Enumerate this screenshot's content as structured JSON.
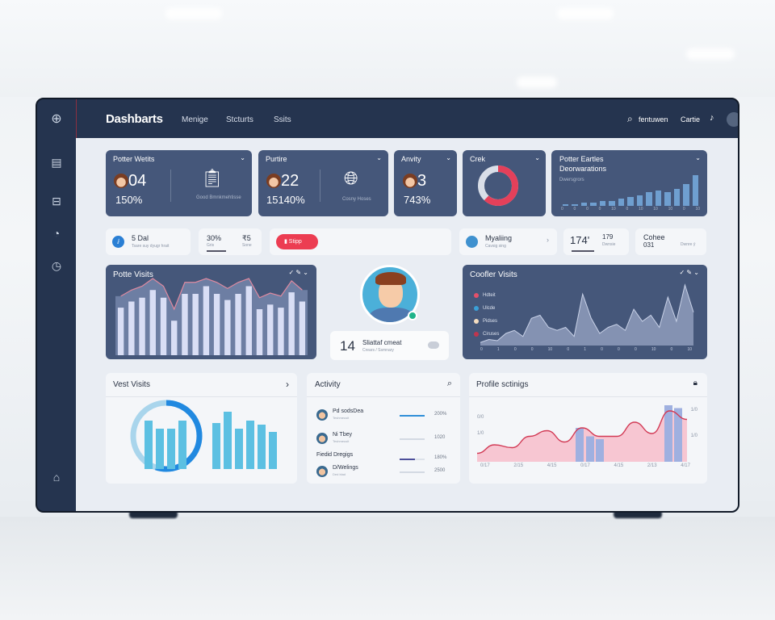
{
  "header": {
    "title": "Dashbarts",
    "nav": [
      "Menige",
      "Stcturts",
      "Ssits"
    ],
    "search_label": "fentuwen",
    "link": "Cartie"
  },
  "cards": [
    {
      "title": "Potter Wetits",
      "value": "04",
      "pct": "150%",
      "sub": "Good Bmnkmehtisse"
    },
    {
      "title": "Purtire",
      "value": "22",
      "pct": "15140%",
      "sub": "Cosny Hoses"
    },
    {
      "title": "Anvity",
      "value": "3",
      "pct": "743%"
    },
    {
      "title": "Crek",
      "donut_fraction": 0.62
    },
    {
      "title": "Potter Eartles",
      "subtitle": "Deorwarations",
      "legend": "Dwersgrors",
      "values": [
        1,
        1,
        2,
        2,
        3,
        3,
        5,
        6,
        7,
        9,
        10,
        9,
        11,
        14,
        20
      ],
      "ticks": [
        "0",
        "0",
        "0",
        "0",
        "10",
        "0",
        "10",
        "10",
        "10",
        "0",
        "10"
      ]
    }
  ],
  "pills": [
    {
      "title": "5 Dal",
      "sub": "Tsare suy dyugr hrait"
    },
    {
      "value1": "30%",
      "sub1": "Gris",
      "value2": "₹5",
      "sub2": "Sone"
    },
    {
      "button": "Stipp"
    },
    {
      "title": "Myaliing",
      "sub": "Cavsig sing"
    },
    {
      "value": "174'",
      "value2": "179",
      "sub": "Dwnsie"
    },
    {
      "title": "Cohee",
      "value": "031",
      "sub": "Dwnre ý"
    }
  ],
  "profile_visits": {
    "title": "Potte Visits",
    "values": [
      0.62,
      0.7,
      0.75,
      0.85,
      0.75,
      0.45,
      0.8,
      0.8,
      0.9,
      0.8,
      0.72,
      0.8,
      0.9,
      0.6,
      0.66,
      0.62,
      0.82,
      0.7
    ]
  },
  "profile": {
    "stat_value": "14",
    "stat_label": "Sliattaf cmeat",
    "stat_sub": "Crears / Ssmnary"
  },
  "coffee_visits": {
    "title": "Coofler Visits",
    "legend": [
      {
        "label": "Hdteit",
        "color": "#e4506a"
      },
      {
        "label": "Ulcde",
        "color": "#3aa0d8"
      },
      {
        "label": "Pidses",
        "color": "#f3dcc0"
      },
      {
        "label": "Ciruses",
        "color": "#c0354e"
      }
    ],
    "values": [
      0.05,
      0.1,
      0.08,
      0.2,
      0.25,
      0.15,
      0.45,
      0.5,
      0.3,
      0.25,
      0.3,
      0.15,
      0.85,
      0.45,
      0.2,
      0.3,
      0.35,
      0.25,
      0.6,
      0.4,
      0.5,
      0.3,
      0.8,
      0.4,
      1.0,
      0.55
    ],
    "ticks": [
      "0",
      "1",
      "0",
      "0",
      "10",
      "0",
      "1",
      "0",
      "0",
      "0",
      "10",
      "0",
      "10"
    ]
  },
  "vest_visits": {
    "title": "Vest Visits",
    "ring_fraction": 0.55,
    "values": [
      0.72,
      0.6,
      0.6,
      0.72,
      0.68,
      0.85,
      0.6,
      0.72,
      0.66,
      0.55
    ]
  },
  "activity": {
    "title": "Activity",
    "items": [
      {
        "name": "Pd sodsDea",
        "sub": "Teshmeusit",
        "value": "200%",
        "progress": 1.0,
        "color": "#2f8ed8"
      },
      {
        "name": "Ni Tbey",
        "sub": "Teshmeusit",
        "value": "1020",
        "progress": 1.0,
        "color": "#d3d9e3"
      },
      {
        "name": "Fiedid Dregigs",
        "sub": "",
        "value": "180%",
        "progress": 0.6,
        "color": "#4c4f9a"
      },
      {
        "name": "D/Welings",
        "sub": "Ded blad",
        "value": "2500",
        "progress": 1.0,
        "color": "#d3d9e3"
      }
    ]
  },
  "profile_settings": {
    "title": "Profile sctinigs",
    "ylabels_left": [
      "0/0",
      "1/0"
    ],
    "ylabels_right": [
      "1/0",
      "1/0"
    ],
    "xticks": [
      "0/17",
      "2/15",
      "4/15",
      "0/17",
      "4/15",
      "2/13",
      "4/17"
    ],
    "line": [
      0.15,
      0.3,
      0.25,
      0.45,
      0.55,
      0.35,
      0.6,
      0.45,
      0.45,
      0.7,
      0.5,
      0.9,
      0.75
    ],
    "bars": [
      0.6,
      0.45,
      0.4,
      1.0,
      0.95
    ]
  }
}
